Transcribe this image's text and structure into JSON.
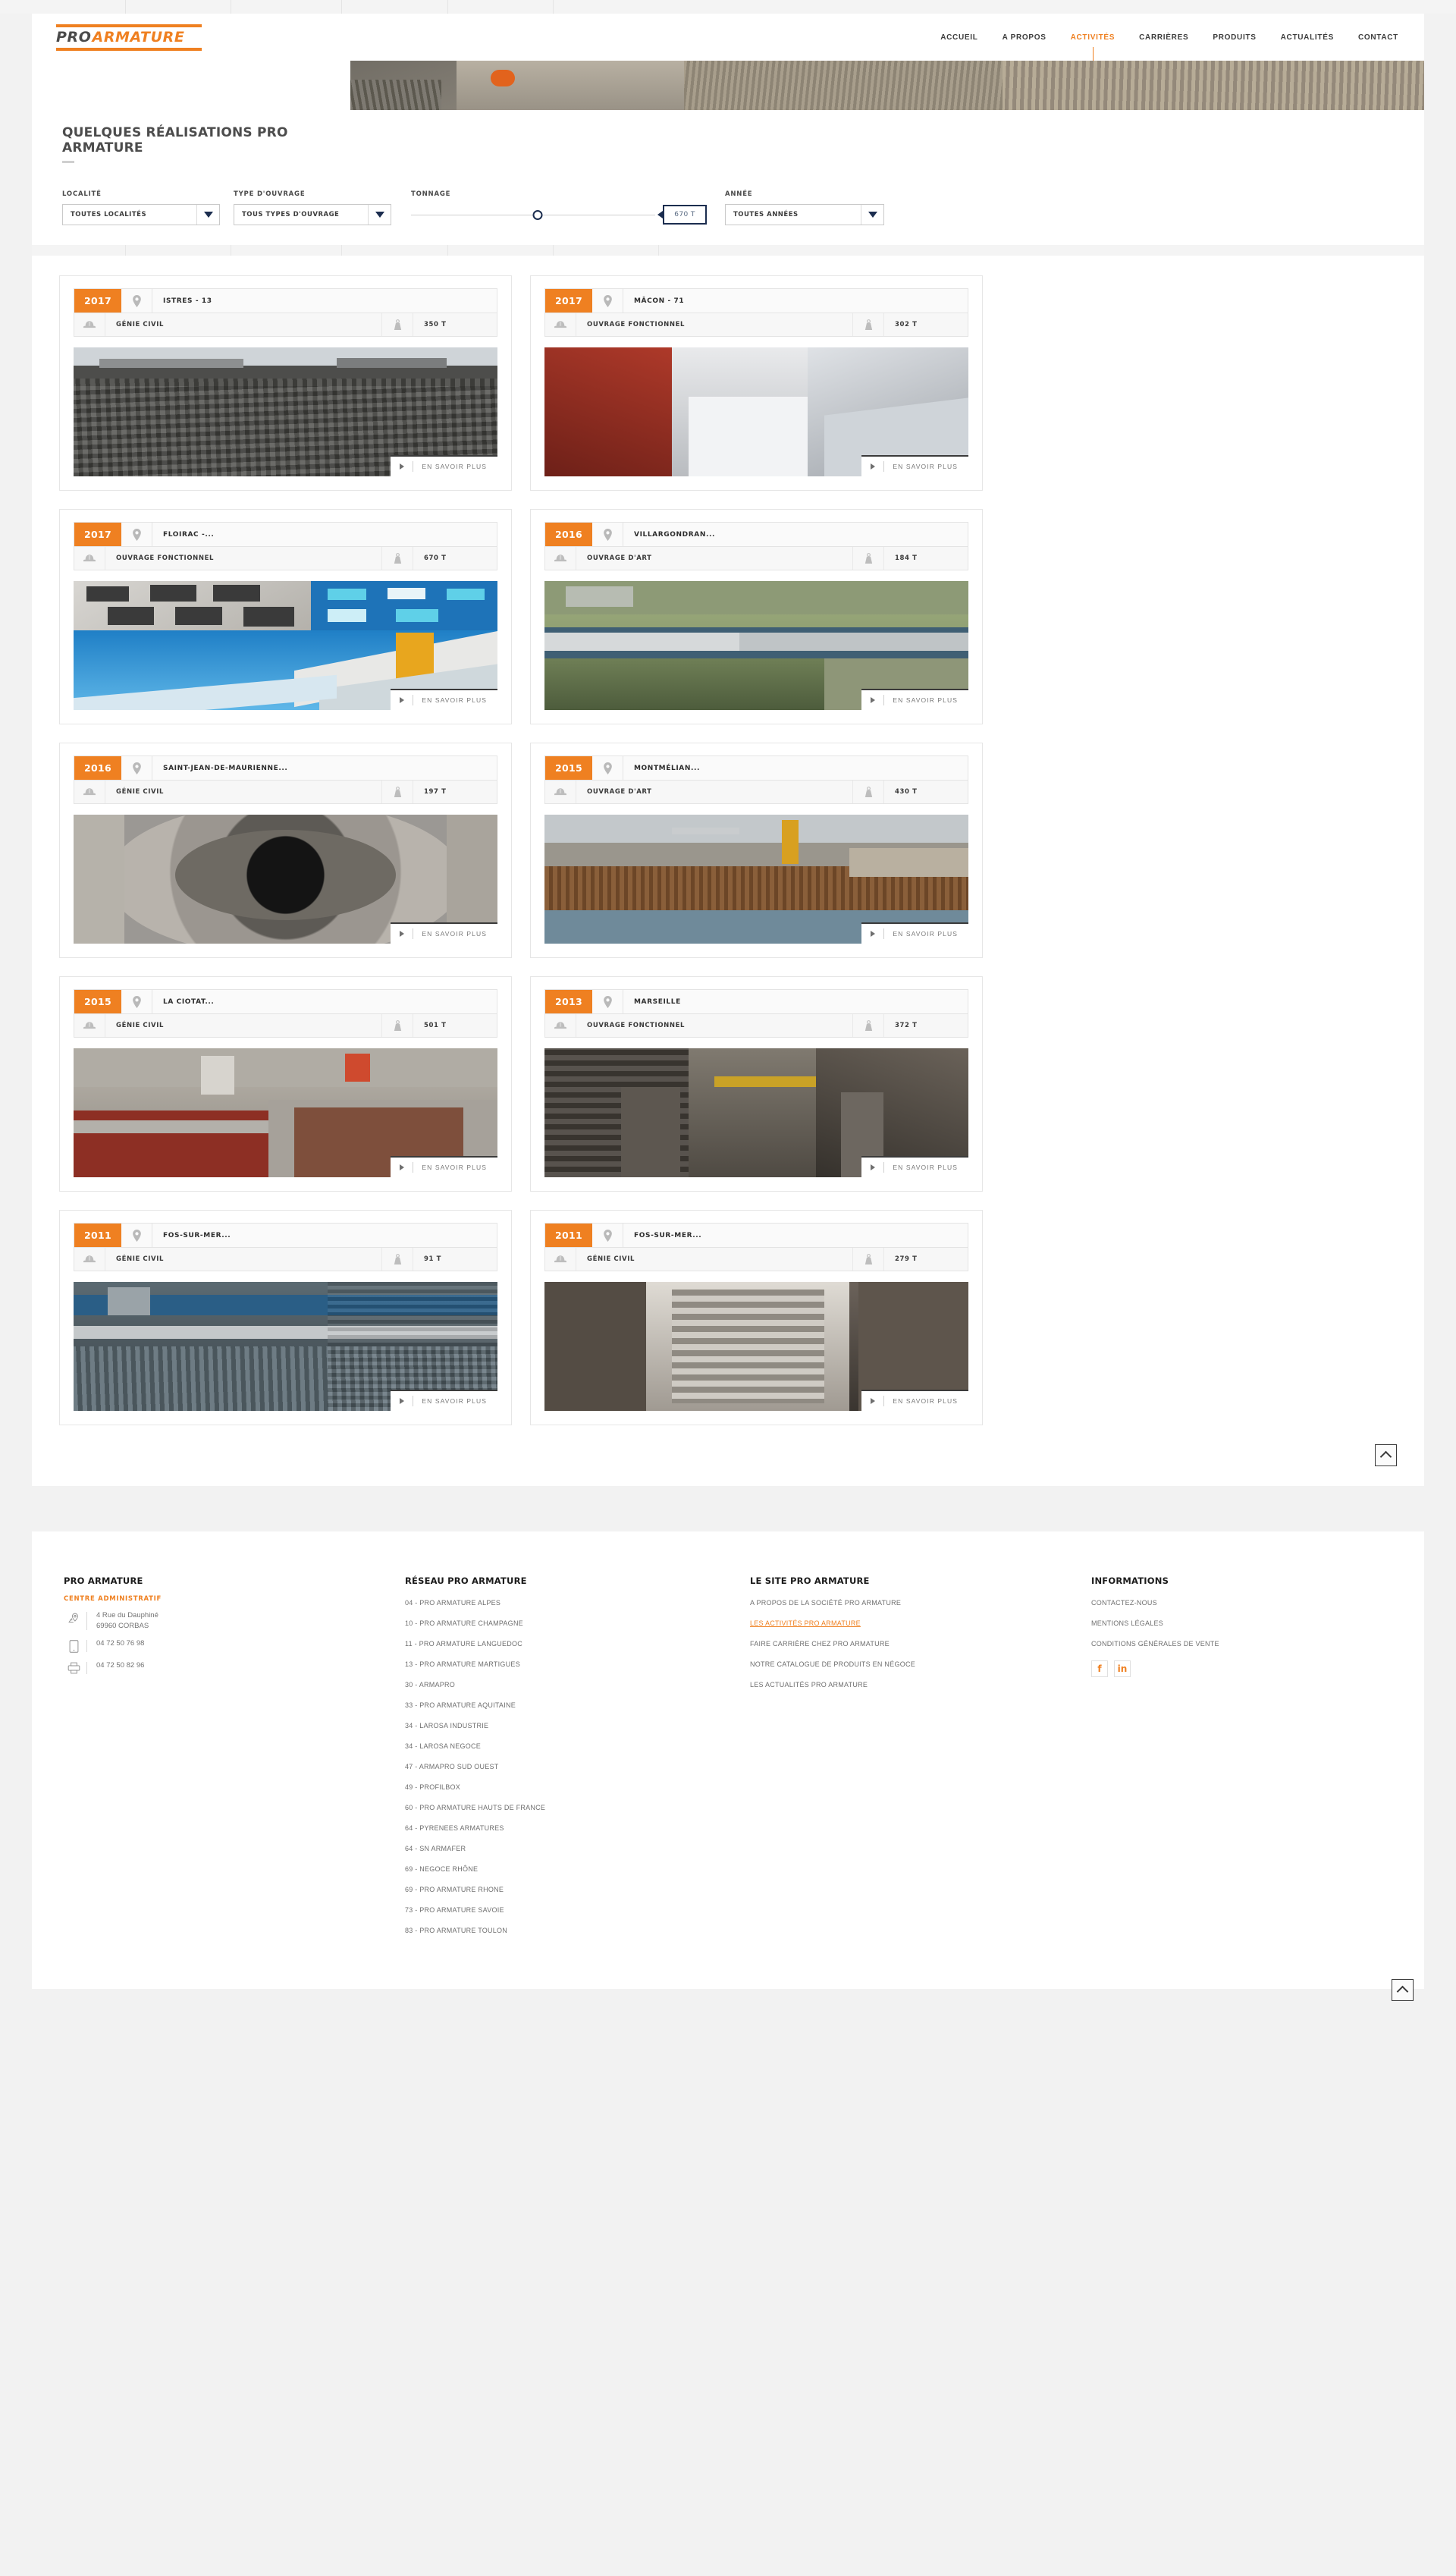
{
  "brand": {
    "logo_part1": "PRO",
    "logo_part2": "ARMATURE",
    "accent": "#ef8021",
    "dark": "#1b2d4f"
  },
  "nav": {
    "items": [
      {
        "label": "ACCUEIL",
        "active": false
      },
      {
        "label": "A PROPOS",
        "active": false
      },
      {
        "label": "ACTIVITÉS",
        "active": true
      },
      {
        "label": "CARRIÈRES",
        "active": false
      },
      {
        "label": "PRODUITS",
        "active": false
      },
      {
        "label": "ACTUALITÉS",
        "active": false
      },
      {
        "label": "CONTACT",
        "active": false
      }
    ]
  },
  "page": {
    "title": "QUELQUES RÉALISATIONS PRO ARMATURE"
  },
  "filters": {
    "locality": {
      "label": "LOCALITÉ",
      "value": "TOUTES LOCALITÉS"
    },
    "type": {
      "label": "TYPE D'OUVRAGE",
      "value": "TOUS TYPES D'OUVRAGE"
    },
    "tonnage": {
      "label": "TONNAGE",
      "value": "670 T",
      "knob_percent": 52
    },
    "year": {
      "label": "ANNÉE",
      "value": "TOUTES ANNÉES"
    }
  },
  "cards": {
    "more_label": "EN SAVOIR PLUS",
    "items": [
      {
        "year": "2017",
        "location": "ISTRES - 13",
        "type": "GÉNIE CIVIL",
        "tonnage": "350 T",
        "image": "istres-rebar-slab"
      },
      {
        "year": "2017",
        "location": "MÂCON - 71",
        "type": "OUVRAGE FONCTIONNEL",
        "tonnage": "302 T",
        "image": "macon-concrete-walls"
      },
      {
        "year": "2017",
        "location": "FLOIRAC -...",
        "type": "OUVRAGE FONCTIONNEL",
        "tonnage": "670 T",
        "image": "floirac-arena-collage"
      },
      {
        "year": "2016",
        "location": "VILLARGONDRAN...",
        "type": "OUVRAGE D'ART",
        "tonnage": "184 T",
        "image": "villargondran-bridge"
      },
      {
        "year": "2016",
        "location": "SAINT-JEAN-DE-MAURIENNE...",
        "type": "GÉNIE CIVIL",
        "tonnage": "197 T",
        "image": "saintjean-circular-shaft"
      },
      {
        "year": "2015",
        "location": "MONTMÉLIAN...",
        "type": "OUVRAGE D'ART",
        "tonnage": "430 T",
        "image": "montmelian-site-crane"
      },
      {
        "year": "2015",
        "location": "LA CIOTAT...",
        "type": "GÉNIE CIVIL",
        "tonnage": "501 T",
        "image": "laciotat-formwork"
      },
      {
        "year": "2013",
        "location": "MARSEILLE",
        "type": "OUVRAGE FONCTIONNEL",
        "tonnage": "372 T",
        "image": "marseille-steel-frame"
      },
      {
        "year": "2011",
        "location": "FOS-SUR-MER...",
        "type": "GÉNIE CIVIL",
        "tonnage": "91 T",
        "image": "fossurmer-pipes"
      },
      {
        "year": "2011",
        "location": "FOS-SUR-MER...",
        "type": "GÉNIE CIVIL",
        "tonnage": "279 T",
        "image": "fossurmer-trench"
      }
    ]
  },
  "scroll_top": {
    "label": "Haut de page"
  },
  "footer": {
    "company": {
      "title": "PRO ARMATURE",
      "subtitle": "CENTRE ADMINISTRATIF",
      "address_line1": "4 Rue du Dauphiné",
      "address_line2": "69960 CORBAS",
      "phone": "04 72 50 76 98",
      "fax": "04 72 50 82 96"
    },
    "network": {
      "title": "RÉSEAU PRO ARMATURE",
      "items": [
        "04 - PRO ARMATURE ALPES",
        "10 - PRO ARMATURE CHAMPAGNE",
        "11 - PRO ARMATURE LANGUEDOC",
        "13 - PRO ARMATURE MARTIGUES",
        "30 - ARMAPRO",
        "33 - PRO ARMATURE AQUITAINE",
        "34 - LAROSA INDUSTRIE",
        "34 - LAROSA NEGOCE",
        "47 - ARMAPRO SUD OUEST",
        "49 - PROFILBOX",
        "60 - PRO ARMATURE HAUTS DE FRANCE",
        "64 - PYRENEES ARMATURES",
        "64 - SN ARMAFER",
        "69 - NEGOCE RHÔNE",
        "69 - PRO ARMATURE RHONE",
        "73 - PRO ARMATURE SAVOIE",
        "83 - PRO ARMATURE TOULON"
      ]
    },
    "site": {
      "title": "LE SITE PRO ARMATURE",
      "items": [
        {
          "label": "A PROPOS DE LA SOCIÉTÉ PRO ARMATURE",
          "highlight": false
        },
        {
          "label": "LES ACTIVITÉS PRO ARMATURE",
          "highlight": true
        },
        {
          "label": "FAIRE CARRIÈRE CHEZ PRO ARMATURE",
          "highlight": false
        },
        {
          "label": "NOTRE CATALOGUE DE PRODUITS EN NÉGOCE",
          "highlight": false
        },
        {
          "label": "LES ACTUALITÉS PRO ARMATURE",
          "highlight": false
        }
      ]
    },
    "info": {
      "title": "INFORMATIONS",
      "items": [
        "CONTACTEZ-NOUS",
        "MENTIONS LÉGALES",
        "CONDITIONS GÉNÉRALES DE VENTE"
      ],
      "socials": [
        {
          "name": "facebook-icon",
          "glyph": "f"
        },
        {
          "name": "linkedin-icon",
          "glyph": "in"
        }
      ]
    }
  }
}
